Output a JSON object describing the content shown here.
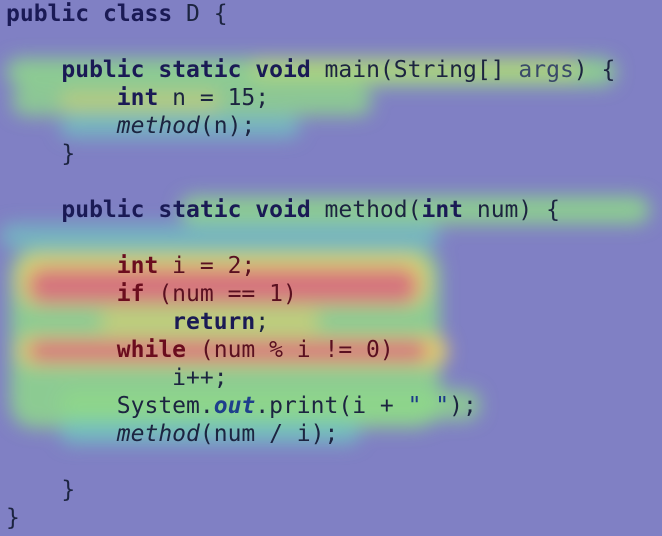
{
  "editor": {
    "language": "java",
    "heatmap_colors": {
      "background": "#8080c4",
      "low": "#6fc8c0",
      "mid": "#8ed88a",
      "high": "#e2cf6c",
      "hot": "#d4707e"
    },
    "lines": [
      {
        "indent": 0,
        "tokens": [
          {
            "t": "public",
            "c": "kw"
          },
          {
            "t": " "
          },
          {
            "t": "class",
            "c": "kw"
          },
          {
            "t": " D {"
          }
        ]
      },
      {
        "indent": 0,
        "tokens": []
      },
      {
        "indent": 1,
        "tokens": [
          {
            "t": "public",
            "c": "kw"
          },
          {
            "t": " "
          },
          {
            "t": "static",
            "c": "kw"
          },
          {
            "t": " "
          },
          {
            "t": "void",
            "c": "kw"
          },
          {
            "t": " main(String[] "
          },
          {
            "t": "args",
            "c": "var"
          },
          {
            "t": ") {"
          }
        ]
      },
      {
        "indent": 2,
        "tokens": [
          {
            "t": "int",
            "c": "kw"
          },
          {
            "t": " n = 15;"
          }
        ]
      },
      {
        "indent": 2,
        "tokens": [
          {
            "t": "method",
            "c": "it"
          },
          {
            "t": "(n);"
          }
        ]
      },
      {
        "indent": 1,
        "tokens": [
          {
            "t": "}"
          }
        ]
      },
      {
        "indent": 0,
        "tokens": []
      },
      {
        "indent": 1,
        "tokens": [
          {
            "t": "public",
            "c": "kw"
          },
          {
            "t": " "
          },
          {
            "t": "static",
            "c": "kw"
          },
          {
            "t": " "
          },
          {
            "t": "void",
            "c": "kw"
          },
          {
            "t": " method("
          },
          {
            "t": "int",
            "c": "kw"
          },
          {
            "t": " num) {"
          }
        ]
      },
      {
        "indent": 0,
        "tokens": []
      },
      {
        "indent": 2,
        "hot": true,
        "tokens": [
          {
            "t": "int",
            "c": "kw"
          },
          {
            "t": " i = 2;"
          }
        ]
      },
      {
        "indent": 2,
        "hot": true,
        "tokens": [
          {
            "t": "if",
            "c": "kw"
          },
          {
            "t": " (num == 1)"
          }
        ]
      },
      {
        "indent": 3,
        "tokens": [
          {
            "t": "return",
            "c": "kw"
          },
          {
            "t": ";"
          }
        ]
      },
      {
        "indent": 2,
        "hot": true,
        "tokens": [
          {
            "t": "while",
            "c": "kw"
          },
          {
            "t": " (num % i != 0)"
          }
        ]
      },
      {
        "indent": 3,
        "tokens": [
          {
            "t": "i++;"
          }
        ]
      },
      {
        "indent": 2,
        "tokens": [
          {
            "t": "System."
          },
          {
            "t": "out",
            "c": "out"
          },
          {
            "t": ".print(i + "
          },
          {
            "t": "\" \"",
            "c": "str"
          },
          {
            "t": ");"
          }
        ]
      },
      {
        "indent": 2,
        "tokens": [
          {
            "t": "method",
            "c": "it"
          },
          {
            "t": "(num / i);"
          }
        ]
      },
      {
        "indent": 0,
        "tokens": []
      },
      {
        "indent": 1,
        "tokens": [
          {
            "t": "}"
          }
        ]
      },
      {
        "indent": 0,
        "tokens": [
          {
            "t": "}"
          }
        ]
      }
    ]
  }
}
